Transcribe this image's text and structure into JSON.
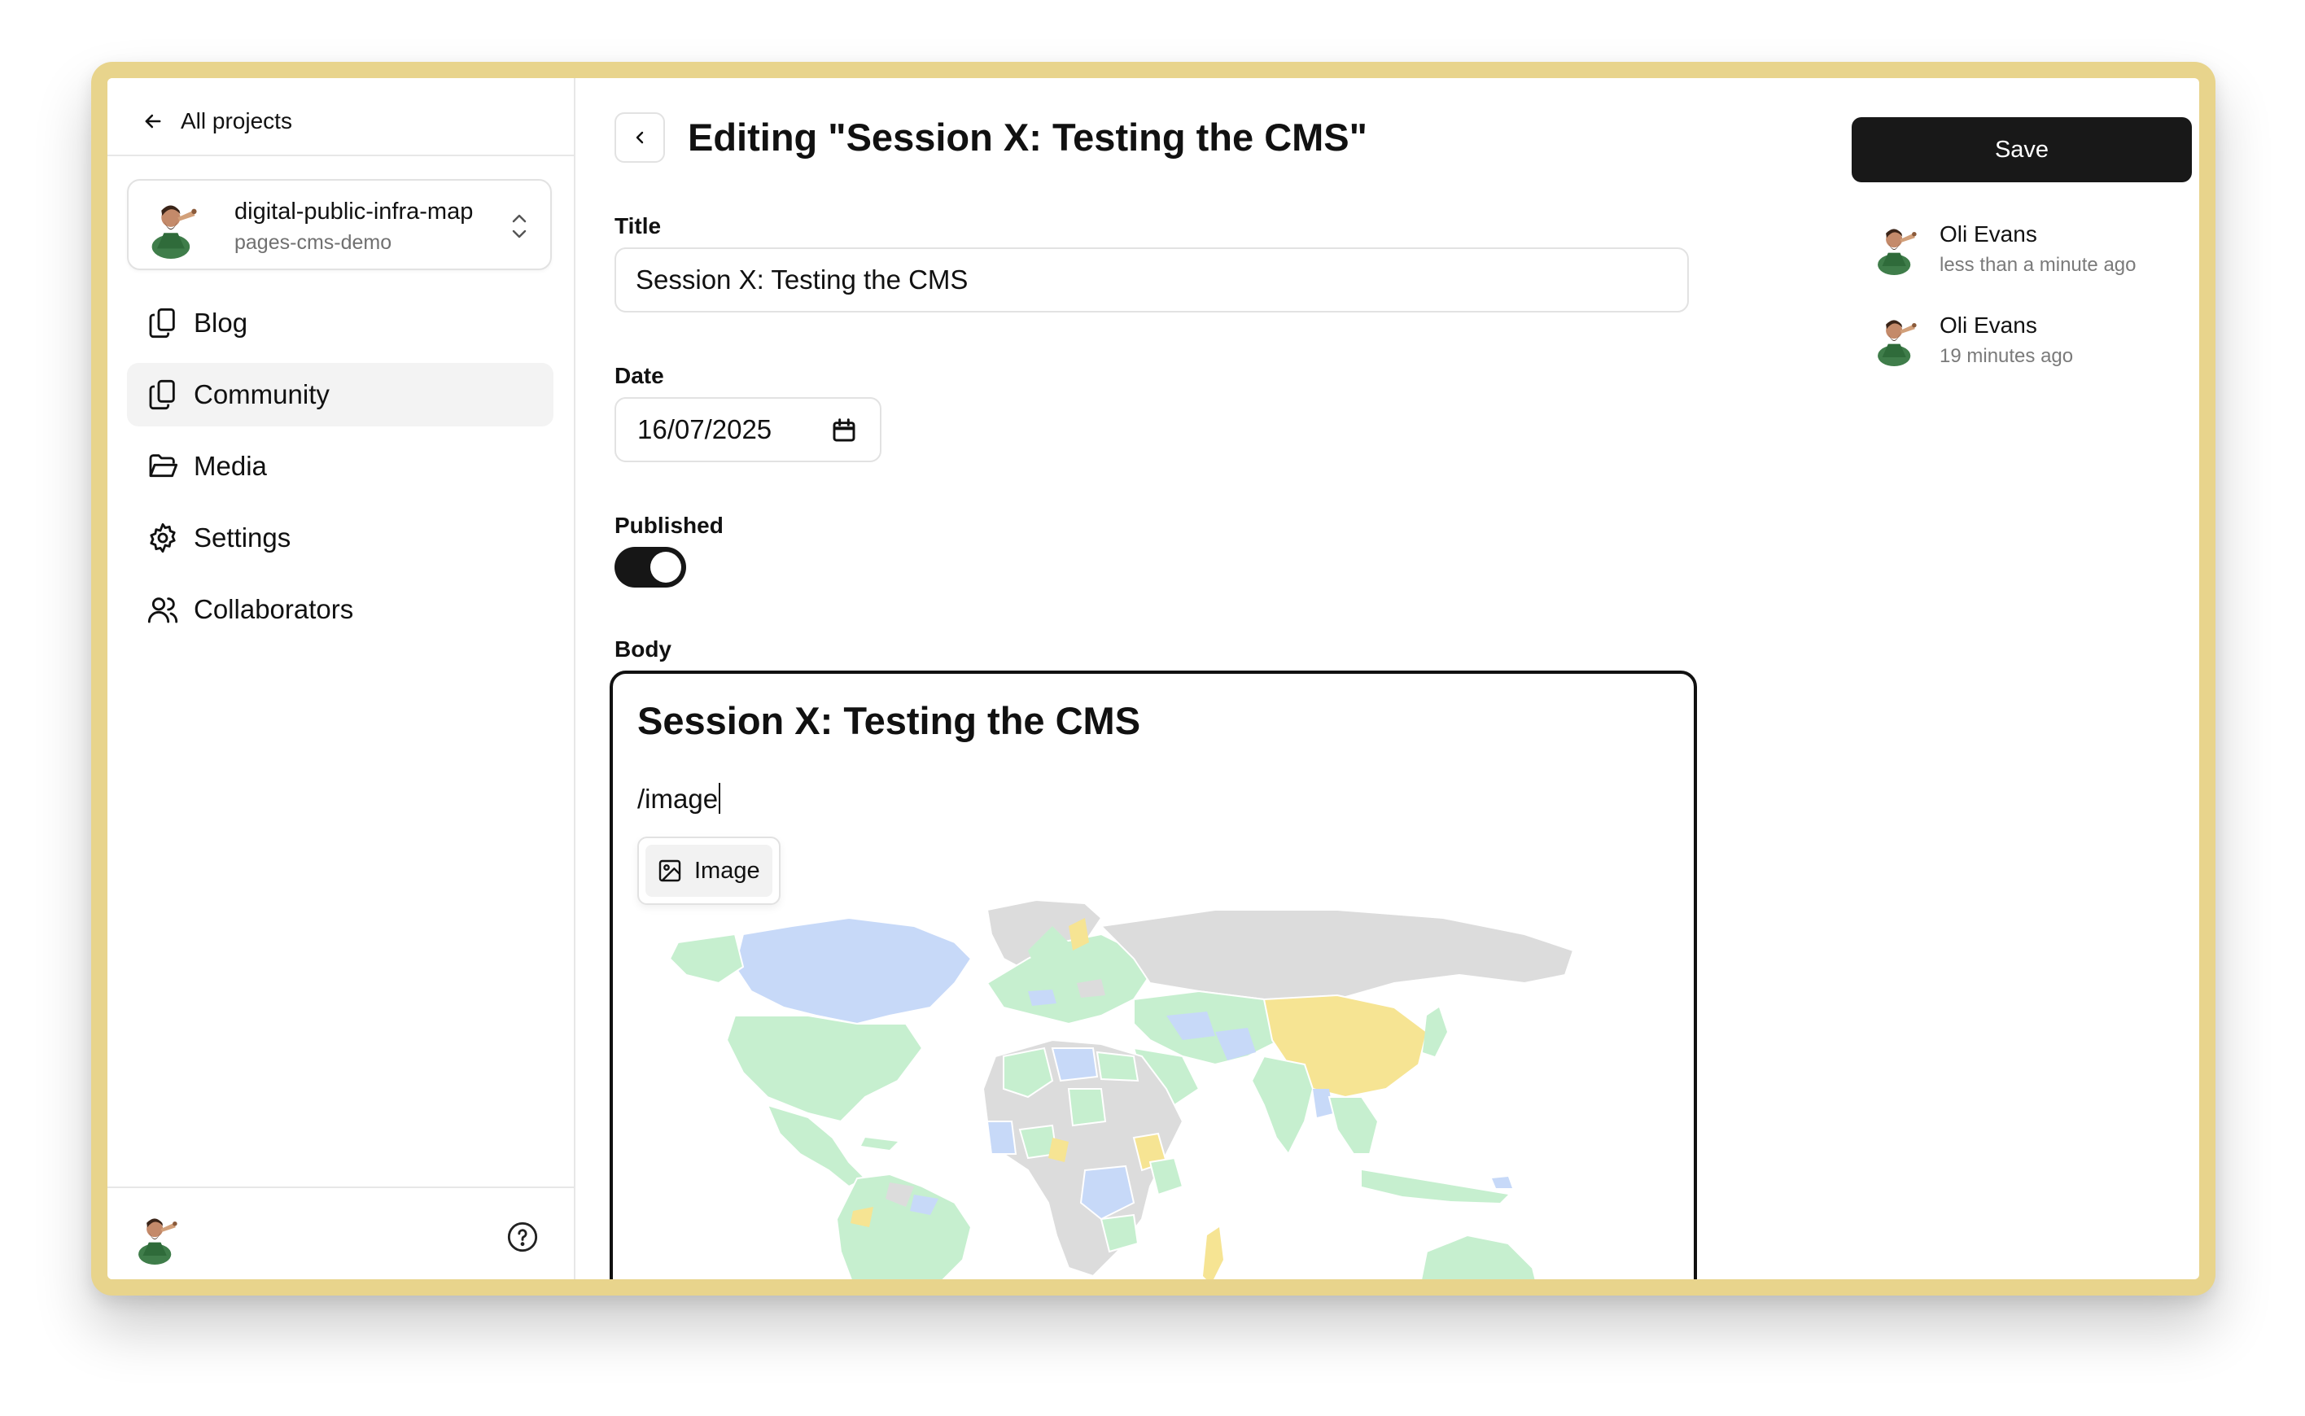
{
  "sidebar": {
    "back_label": "All projects",
    "project": {
      "name": "digital-public-infra-map",
      "subtitle": "pages-cms-demo"
    },
    "nav": [
      {
        "label": "Blog",
        "icon": "files-icon"
      },
      {
        "label": "Community",
        "icon": "files-icon",
        "active": true
      },
      {
        "label": "Media",
        "icon": "folder-open-icon"
      },
      {
        "label": "Settings",
        "icon": "gear-icon"
      },
      {
        "label": "Collaborators",
        "icon": "users-icon"
      }
    ]
  },
  "header": {
    "title": "Editing \"Session X: Testing the CMS\""
  },
  "form": {
    "title_label": "Title",
    "title_value": "Session X: Testing the CMS",
    "date_label": "Date",
    "date_value": "16/07/2025",
    "published_label": "Published",
    "published_on": true,
    "body_label": "Body"
  },
  "editor": {
    "heading": "Session X: Testing the CMS",
    "typed_command": "/image",
    "menu_items": [
      {
        "label": "Image",
        "icon": "image-icon"
      }
    ]
  },
  "actions": {
    "save_label": "Save"
  },
  "history": [
    {
      "name": "Oli Evans",
      "time": "less than a minute ago"
    },
    {
      "name": "Oli Evans",
      "time": "19 minutes ago"
    }
  ],
  "colors": {
    "primary": "#181818",
    "map_green": "#c6efcf",
    "map_blue": "#c7d9f8",
    "map_yellow": "#f6e493",
    "map_gray": "#dcdcdc"
  }
}
